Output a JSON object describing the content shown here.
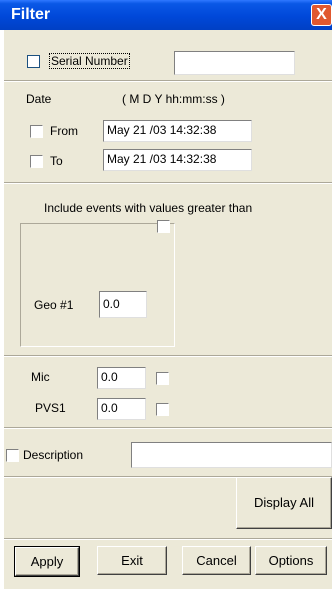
{
  "window": {
    "title": "Filter",
    "close_symbol": "X"
  },
  "serial": {
    "label": "Serial Number",
    "value": ""
  },
  "date": {
    "label": "Date",
    "format": "( M D Y  hh:mm:ss )",
    "from_label": "From",
    "from_value": "May 21 /03 14:32:38",
    "to_label": "To",
    "to_value": "May 21 /03 14:32:38"
  },
  "include": {
    "heading": "Include events with values greater than",
    "geo_label": "Geo #1",
    "geo_value": "0.0",
    "mic_label": "Mic",
    "mic_value": "0.0",
    "pvs_label": "PVS1",
    "pvs_value": "0.0"
  },
  "description": {
    "label": "Description",
    "value": ""
  },
  "buttons": {
    "display_all": "Display All",
    "apply": "Apply",
    "exit": "Exit",
    "cancel": "Cancel",
    "options": "Options"
  }
}
